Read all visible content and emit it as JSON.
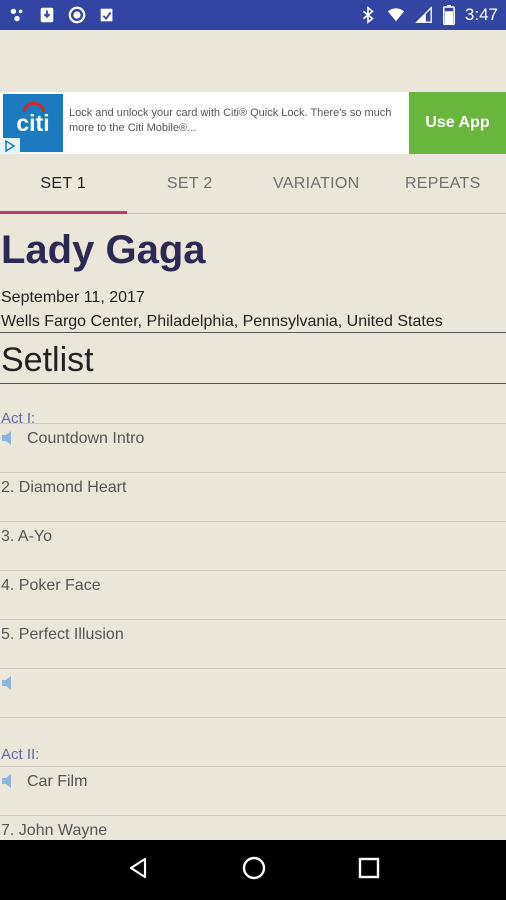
{
  "status_bar": {
    "time": "3:47",
    "battery_level": 80
  },
  "ad": {
    "logo_text": "citi",
    "text": "Lock and unlock your card with Citi® Quick Lock. There's so much more to the Citi Mobile®...",
    "cta": "Use App"
  },
  "tabs": [
    {
      "label": "SET 1"
    },
    {
      "label": "SET 2"
    },
    {
      "label": "VARIATION"
    },
    {
      "label": "REPEATS"
    }
  ],
  "concert": {
    "artist": "Lady Gaga",
    "date": "September 11, 2017",
    "venue": "Wells Fargo Center, Philadelphia, Pennsylvania, United States"
  },
  "setlist": {
    "title": "Setlist",
    "act1_label": "Act I:",
    "act2_label": "Act II:",
    "songs": [
      {
        "label": "Countdown Intro"
      },
      {
        "label": "2. Diamond Heart"
      },
      {
        "label": "3. A-Yo"
      },
      {
        "label": "4. Poker Face"
      },
      {
        "label": "5. Perfect Illusion"
      },
      {
        "label": ""
      },
      {
        "label": "Car Film"
      },
      {
        "label": "7. John Wayne"
      }
    ]
  }
}
